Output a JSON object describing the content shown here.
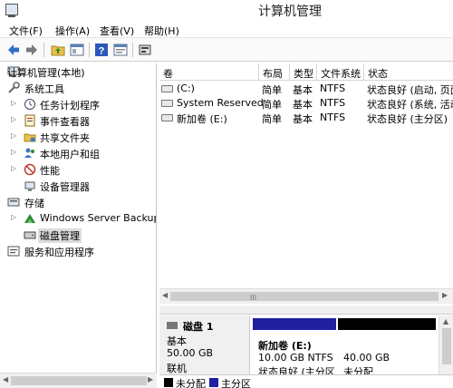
{
  "window": {
    "title": "计算机管理"
  },
  "menu": [
    "文件(F)",
    "操作(A)",
    "查看(V)",
    "帮助(H)"
  ],
  "toolbar": {
    "icons": [
      "back-icon",
      "forward-icon",
      "up-folder-icon",
      "show-hide-tree-icon",
      "help-icon",
      "properties-icon",
      "disk-settings-icon"
    ],
    "colors": {
      "back": "#2f6fc4",
      "forward": "#7a7a7a",
      "help": "#2a58b8"
    }
  },
  "tree": {
    "root": "计算机管理(本地)",
    "items": [
      {
        "label": "系统工具",
        "icon": "tools-icon"
      },
      {
        "label": "任务计划程序",
        "icon": "clock-icon"
      },
      {
        "label": "事件查看器",
        "icon": "event-viewer-icon"
      },
      {
        "label": "共享文件夹",
        "icon": "shared-folder-icon"
      },
      {
        "label": "本地用户和组",
        "icon": "users-icon"
      },
      {
        "label": "性能",
        "icon": "performance-icon"
      },
      {
        "label": "设备管理器",
        "icon": "device-manager-icon"
      },
      {
        "label": "存储",
        "icon": "storage-icon"
      },
      {
        "label": "Windows Server Backup",
        "icon": "backup-icon"
      },
      {
        "label": "磁盘管理",
        "icon": "disk-management-icon"
      },
      {
        "label": "服务和应用程序",
        "icon": "services-icon"
      }
    ]
  },
  "volumes": {
    "headers": [
      "卷",
      "布局",
      "类型",
      "文件系统",
      "状态"
    ],
    "rows": [
      [
        "(C:)",
        "简单",
        "基本",
        "NTFS",
        "状态良好 (启动, 页面"
      ],
      [
        "System Reserved",
        "简单",
        "基本",
        "NTFS",
        "状态良好 (系统, 活动"
      ],
      [
        "新加卷 (E:)",
        "简单",
        "基本",
        "NTFS",
        "状态良好 (主分区)"
      ]
    ]
  },
  "disk": {
    "name": "磁盘 1",
    "type": "基本",
    "size": "50.00 GB",
    "status": "联机",
    "partitions": [
      {
        "name": "新加卷 (E:)",
        "size": "10.00 GB NTFS",
        "status": "状态良好 (主分区",
        "color": "#1f1fa0"
      },
      {
        "name": "",
        "size": "40.00 GB",
        "status": "未分配",
        "color": "#000000"
      }
    ]
  },
  "legend": [
    {
      "label": "未分配",
      "color": "#000000"
    },
    {
      "label": "主分区",
      "color": "#1f1fa0"
    }
  ],
  "scrollbar": {
    "grip": "III"
  }
}
